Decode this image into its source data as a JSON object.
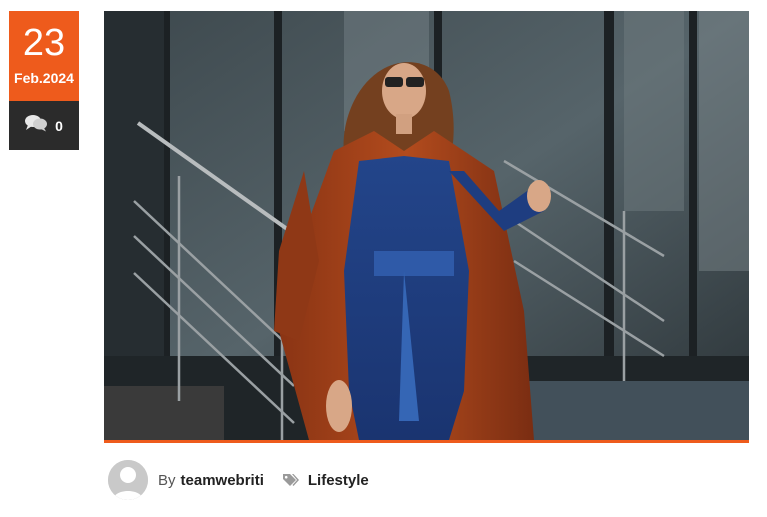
{
  "post": {
    "date_day": "23",
    "date_month": "Feb.2024",
    "comment_count": "0",
    "image_alt": "Woman in a rust coat and blue suit standing by a glass building",
    "author_prefix": "By",
    "author": "teamwebriti",
    "category": "Lifestyle"
  },
  "icons": {
    "comments": "comments-icon",
    "tag": "tag-icon",
    "avatar": "user-avatar-icon"
  },
  "colors": {
    "accent": "#ee5b1c",
    "dark_box": "#2b2b2b"
  }
}
